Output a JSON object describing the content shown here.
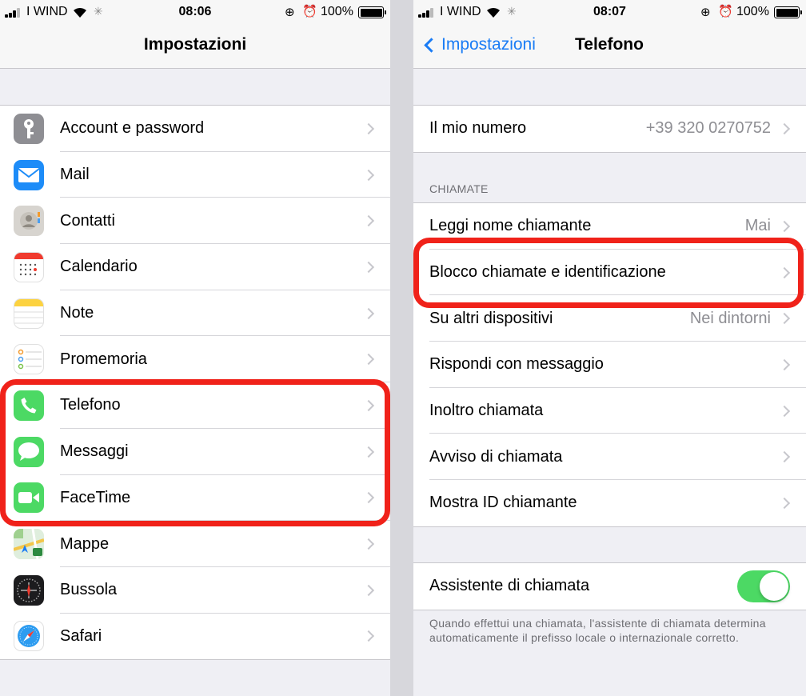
{
  "left": {
    "status": {
      "carrier": "I WIND",
      "time": "08:06",
      "battery": "100%"
    },
    "nav_title": "Impostazioni",
    "items": [
      {
        "label": "Account e password",
        "icon": "key-icon"
      },
      {
        "label": "Mail",
        "icon": "mail-icon"
      },
      {
        "label": "Contatti",
        "icon": "contacts-icon"
      },
      {
        "label": "Calendario",
        "icon": "calendar-icon"
      },
      {
        "label": "Note",
        "icon": "notes-icon"
      },
      {
        "label": "Promemoria",
        "icon": "reminders-icon"
      },
      {
        "label": "Telefono",
        "icon": "phone-icon"
      },
      {
        "label": "Messaggi",
        "icon": "messages-icon"
      },
      {
        "label": "FaceTime",
        "icon": "facetime-icon"
      },
      {
        "label": "Mappe",
        "icon": "maps-icon"
      },
      {
        "label": "Bussola",
        "icon": "compass-icon"
      },
      {
        "label": "Safari",
        "icon": "safari-icon"
      }
    ]
  },
  "right": {
    "status": {
      "carrier": "I WIND",
      "time": "08:07",
      "battery": "100%"
    },
    "back_label": "Impostazioni",
    "nav_title": "Telefono",
    "my_number": {
      "label": "Il mio numero",
      "value": "+39 320 0270752"
    },
    "calls_header": "CHIAMATE",
    "calls": [
      {
        "label": "Leggi nome chiamante",
        "value": "Mai"
      },
      {
        "label": "Blocco chiamate e identificazione",
        "value": ""
      },
      {
        "label": "Su altri dispositivi",
        "value": "Nei dintorni"
      },
      {
        "label": "Rispondi con messaggio",
        "value": ""
      },
      {
        "label": "Inoltro chiamata",
        "value": ""
      },
      {
        "label": "Avviso di chiamata",
        "value": ""
      },
      {
        "label": "Mostra ID chiamante",
        "value": ""
      }
    ],
    "assistant": {
      "label": "Assistente di chiamata",
      "on": true
    },
    "assistant_note": "Quando effettui una chiamata, l'assistente di chiamata determina automaticamente il prefisso locale o internazionale corretto."
  },
  "colors": {
    "accent": "#1a7cf5",
    "toggle_on": "#4cd964",
    "highlight": "#f0221a"
  }
}
